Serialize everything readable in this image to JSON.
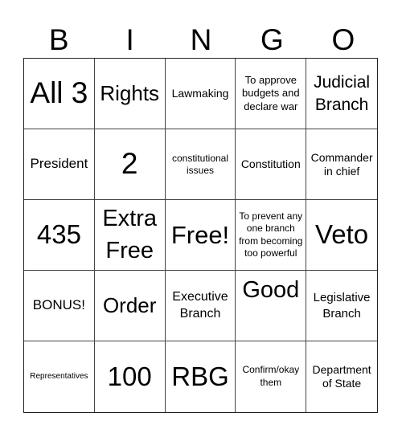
{
  "card": {
    "header": [
      "B",
      "I",
      "N",
      "G",
      "O"
    ],
    "cells": [
      "All 3",
      "Rights",
      "Lawmaking",
      "To approve budgets and declare war",
      "Judicial Branch",
      "President",
      "2",
      "constitutional issues",
      "Constitution",
      "Commander in chief",
      "435",
      "Extra Free",
      "Free!",
      "To prevent any one branch from becoming too powerful",
      "Veto",
      "BONUS!",
      "Order",
      "Executive Branch",
      "Good",
      "Legislative Branch",
      "Representatives",
      "100",
      "RBG",
      "Confirm/okay them",
      "Department of State"
    ]
  }
}
